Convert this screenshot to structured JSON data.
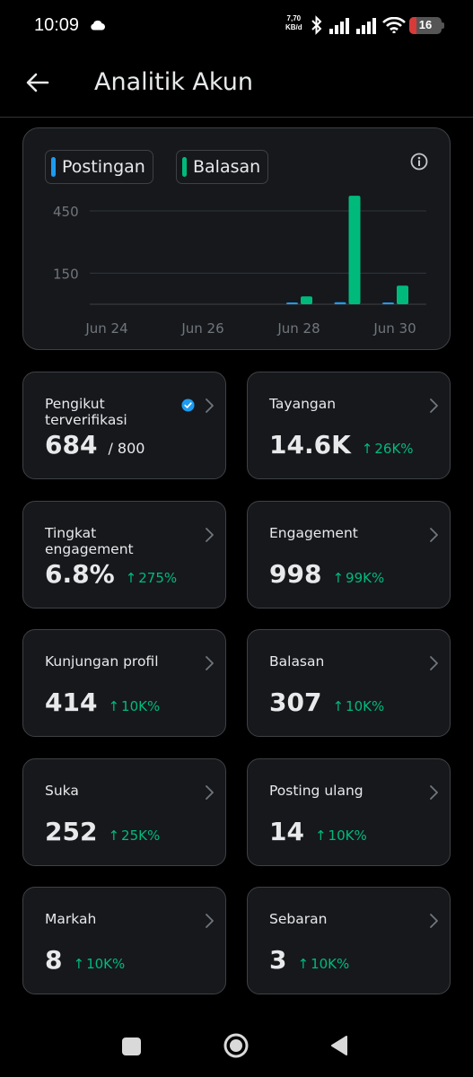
{
  "status_bar": {
    "time": "10:09",
    "speed_value": "7,70",
    "speed_unit": "KB/d",
    "battery": "16"
  },
  "header": {
    "title": "Analitik Akun"
  },
  "chart_data": {
    "type": "bar",
    "legend": [
      "Postingan",
      "Balasan"
    ],
    "x_tick_labels": [
      "Jun 24",
      "Jun 26",
      "Jun 28",
      "Jun 30"
    ],
    "y_tick_labels": [
      "450",
      "150"
    ],
    "categories": [
      "Jun 24",
      "Jun 25",
      "Jun 26",
      "Jun 27",
      "Jun 28",
      "Jun 29",
      "Jun 30"
    ],
    "series": [
      {
        "name": "Postingan",
        "color": "#1d9bf0",
        "values": [
          0,
          0,
          0,
          0,
          6,
          10,
          5
        ]
      },
      {
        "name": "Balasan",
        "color": "#00ba7c",
        "values": [
          0,
          0,
          0,
          0,
          38,
          523,
          90
        ]
      }
    ],
    "ylim": [
      0,
      600
    ],
    "grid": true,
    "legend_placement": "top-left"
  },
  "stats": [
    {
      "label": "Pengikut terverifikasi",
      "value": "684",
      "sub": "/ 800",
      "change": "",
      "verified": true
    },
    {
      "label": "Tayangan",
      "value": "14.6K",
      "sub": "",
      "change": "26K%"
    },
    {
      "label": "Tingkat engagement",
      "value": "6.8%",
      "sub": "",
      "change": "275%"
    },
    {
      "label": "Engagement",
      "value": "998",
      "sub": "",
      "change": "99K%"
    },
    {
      "label": "Kunjungan profil",
      "value": "414",
      "sub": "",
      "change": "10K%"
    },
    {
      "label": "Balasan",
      "value": "307",
      "sub": "",
      "change": "10K%"
    },
    {
      "label": "Suka",
      "value": "252",
      "sub": "",
      "change": "25K%"
    },
    {
      "label": "Posting ulang",
      "value": "14",
      "sub": "",
      "change": "10K%"
    },
    {
      "label": "Markah",
      "value": "8",
      "sub": "",
      "change": "10K%"
    },
    {
      "label": "Sebaran",
      "value": "3",
      "sub": "",
      "change": "10K%"
    }
  ],
  "icons": {
    "back": "arrow-left-icon",
    "info": "info-icon",
    "chevron": "chevron-right-icon",
    "verified": "verified-badge-icon",
    "nav_recents": "square-icon",
    "nav_home": "circle-icon",
    "nav_back": "triangle-back-icon"
  },
  "colors": {
    "accent_blue": "#1d9bf0",
    "accent_green": "#00ba7c",
    "card_bg": "#16181c",
    "border": "#3e4144"
  }
}
